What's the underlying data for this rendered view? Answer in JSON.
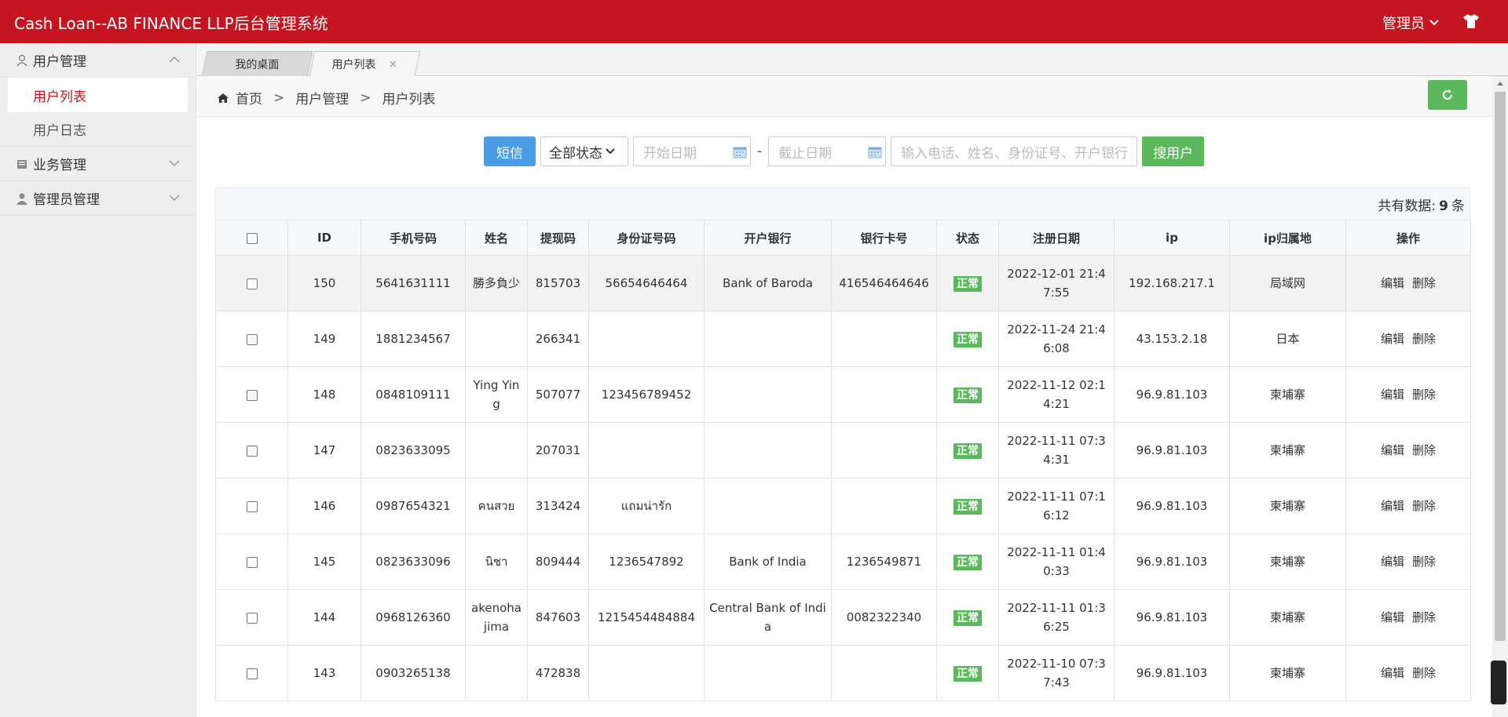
{
  "header": {
    "app_title": "Cash Loan--AB FINANCE LLP后台管理系统",
    "admin_label": "管理员"
  },
  "sidebar": {
    "groups": [
      {
        "label": "用户管理",
        "expanded": true,
        "items": [
          {
            "label": "用户列表",
            "active": true
          },
          {
            "label": "用户日志",
            "active": false
          }
        ]
      },
      {
        "label": "业务管理",
        "expanded": false
      },
      {
        "label": "管理员管理",
        "expanded": false
      }
    ]
  },
  "tabs": [
    {
      "label": "我的桌面"
    },
    {
      "label": "用户列表",
      "close": "×"
    }
  ],
  "breadcrumb": {
    "home": "首页",
    "sep": ">",
    "level1": "用户管理",
    "level2": "用户列表"
  },
  "toolbar": {
    "sms_label": "短信",
    "status_select": "全部状态",
    "start_date_placeholder": "开始日期",
    "dash": "-",
    "end_date_placeholder": "截止日期",
    "search_placeholder": "输入电话、姓名、身份证号、开户银行",
    "search_button": "搜用户"
  },
  "summary": {
    "prefix": "共有数据:",
    "count": "9",
    "suffix": "条"
  },
  "table": {
    "columns": [
      "ID",
      "手机号码",
      "姓名",
      "提现码",
      "身份证号码",
      "开户银行",
      "银行卡号",
      "状态",
      "注册日期",
      "ip",
      "ip归属地",
      "操作"
    ],
    "edit_label": "编辑",
    "delete_label": "删除",
    "rows": [
      {
        "id": "150",
        "phone": "5641631111",
        "name": "勝多負少",
        "code": "815703",
        "idcard": "56654646464",
        "bank": "Bank of Baroda",
        "card": "416546464646",
        "status": "正常",
        "date": "2022-12-01 21:47:55",
        "ip": "192.168.217.1",
        "loc": "局域网"
      },
      {
        "id": "149",
        "phone": "1881234567",
        "name": "",
        "code": "266341",
        "idcard": "",
        "bank": "",
        "card": "",
        "status": "正常",
        "date": "2022-11-24 21:46:08",
        "ip": "43.153.2.18",
        "loc": "日本"
      },
      {
        "id": "148",
        "phone": "0848109111",
        "name": "Ying Ying",
        "code": "507077",
        "idcard": "123456789452",
        "bank": "",
        "card": "",
        "status": "正常",
        "date": "2022-11-12 02:14:21",
        "ip": "96.9.81.103",
        "loc": "柬埔寨"
      },
      {
        "id": "147",
        "phone": "0823633095",
        "name": "",
        "code": "207031",
        "idcard": "",
        "bank": "",
        "card": "",
        "status": "正常",
        "date": "2022-11-11 07:34:31",
        "ip": "96.9.81.103",
        "loc": "柬埔寨"
      },
      {
        "id": "146",
        "phone": "0987654321",
        "name": "คนสวย",
        "code": "313424",
        "idcard": "แถมน่ารัก",
        "bank": "",
        "card": "",
        "status": "正常",
        "date": "2022-11-11 07:16:12",
        "ip": "96.9.81.103",
        "loc": "柬埔寨"
      },
      {
        "id": "145",
        "phone": "0823633096",
        "name": "นิชา",
        "code": "809444",
        "idcard": "1236547892",
        "bank": "Bank of India",
        "card": "1236549871",
        "status": "正常",
        "date": "2022-11-11 01:40:33",
        "ip": "96.9.81.103",
        "loc": "柬埔寨"
      },
      {
        "id": "144",
        "phone": "0968126360",
        "name": "akenohajima",
        "code": "847603",
        "idcard": "1215454484884",
        "bank": "Central Bank of India",
        "card": "0082322340",
        "status": "正常",
        "date": "2022-11-11 01:36:25",
        "ip": "96.9.81.103",
        "loc": "柬埔寨"
      },
      {
        "id": "143",
        "phone": "0903265138",
        "name": "",
        "code": "472838",
        "idcard": "",
        "bank": "",
        "card": "",
        "status": "正常",
        "date": "2022-11-10 07:37:43",
        "ip": "96.9.81.103",
        "loc": "柬埔寨"
      }
    ]
  },
  "colors": {
    "brand_red": "#c41521",
    "green": "#5cb85c",
    "blue": "#4a9de4"
  }
}
